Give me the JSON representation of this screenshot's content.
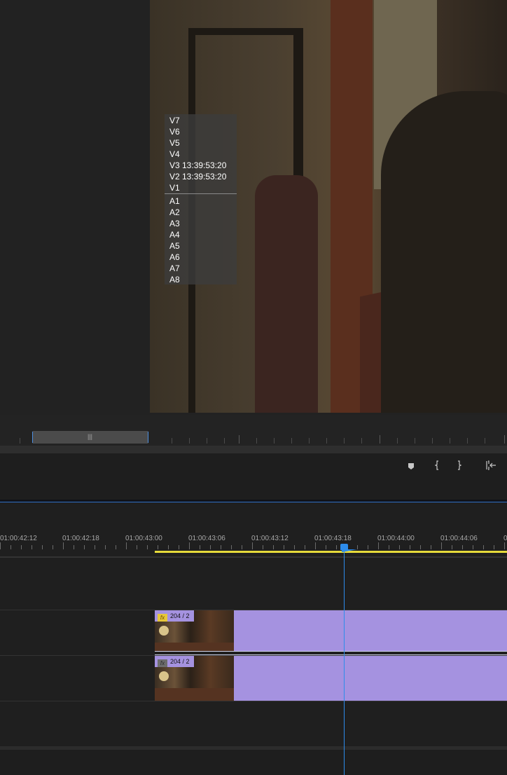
{
  "track_overlay": {
    "video_tracks": [
      "V7",
      "V6",
      "V5",
      "V4",
      "V3 13:39:53:20",
      "V2 13:39:53:20",
      "V1"
    ],
    "audio_tracks": [
      "A1",
      "A2",
      "A3",
      "A4",
      "A5",
      "A6",
      "A7",
      "A8"
    ]
  },
  "controls": {
    "icons": [
      "add-marker-icon",
      "mark-in-icon",
      "mark-out-icon",
      "go-to-in-icon"
    ]
  },
  "timeline": {
    "timecodes": [
      "01:00:42:12",
      "01:00:42:18",
      "01:00:43:00",
      "01:00:43:06",
      "01:00:43:12",
      "01:00:43:18",
      "01:00:44:00",
      "01:00:44:06",
      "0"
    ],
    "clips": [
      {
        "label": "204 / 2",
        "fx_active": true
      },
      {
        "label": "204 / 2",
        "fx_active": false
      }
    ],
    "fx_glyph": "fx",
    "colors": {
      "clip": "#a592e0",
      "playhead": "#2d8ceb",
      "work_area": "#e6da3a",
      "fx_badge": "#e6c63a"
    }
  }
}
